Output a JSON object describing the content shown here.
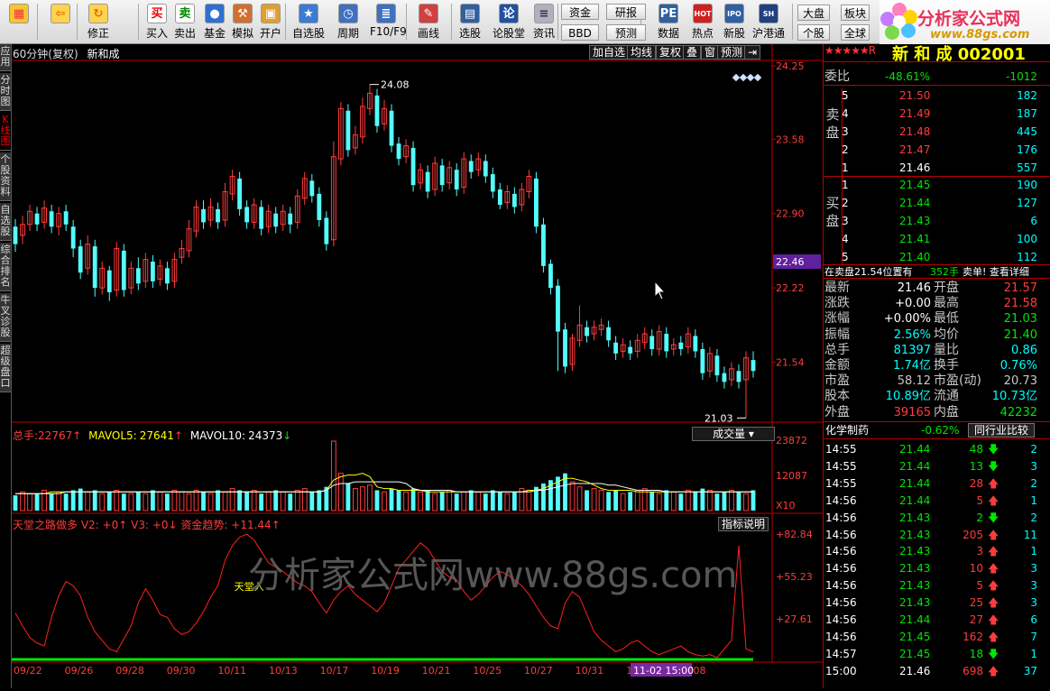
{
  "toolbar": {
    "buttons": [
      {
        "label": "",
        "icon": "grid-icon"
      },
      {
        "label": "",
        "icon": "back-arrow-icon"
      },
      {
        "label": "修正",
        "icon": "adjust-icon"
      },
      {
        "label": "买入",
        "icon": "buy-icon",
        "glyph": "买"
      },
      {
        "label": "卖出",
        "icon": "sell-icon",
        "glyph": "卖"
      },
      {
        "label": "基金",
        "icon": "fund-icon"
      },
      {
        "label": "模拟",
        "icon": "hammer-icon"
      },
      {
        "label": "开户",
        "icon": "lock-icon"
      },
      {
        "label": "自选股",
        "icon": "star-list-icon"
      },
      {
        "label": "周期",
        "icon": "clock-icon"
      },
      {
        "label": "F10/F9",
        "icon": "f10-icon"
      },
      {
        "label": "画线",
        "icon": "pen-icon"
      },
      {
        "label": "选股",
        "icon": "screen-icon"
      },
      {
        "label": "论股堂",
        "icon": "forum-icon",
        "glyph": "论"
      },
      {
        "label": "资讯",
        "icon": "news-icon"
      },
      {
        "label": "数据",
        "icon": "pe-icon",
        "glyph": "PE"
      },
      {
        "label": "热点",
        "icon": "hot-icon",
        "glyph": "HOT"
      },
      {
        "label": "新股",
        "icon": "ipo-icon",
        "glyph": "IPO"
      },
      {
        "label": "沪港通",
        "icon": "shhk-icon",
        "glyph": "SH HK"
      }
    ],
    "small": {
      "fund": "资金",
      "bbd": "BBD",
      "research": "研报",
      "forecast": "预测",
      "dapan": "大盘",
      "bankuai": "板块",
      "gegu": "个股",
      "quanqiu": "全球"
    }
  },
  "logo": {
    "line1": "分析家公式网",
    "line2": "www.88gs.com"
  },
  "lefttabs": [
    "应用",
    "分时图",
    "K线图",
    "个股资料",
    "自选股",
    "综合排名",
    "牛叉诊股",
    "超级盘口"
  ],
  "chart_header": {
    "title": "60分钟(复权)",
    "name": "新和成",
    "buttons": [
      "加自选",
      "均线",
      "复权",
      "叠",
      "窗",
      "预测",
      "⇥"
    ]
  },
  "price_axis": [
    "24.25",
    "23.58",
    "22.90",
    "22.22",
    "21.54"
  ],
  "current_price_label": "22.46",
  "volume_header": {
    "total_label": "总手:",
    "total": "22767",
    "mavol5_label": "MAVOL5:",
    "mavol5": "27641",
    "mavol10_label": "MAVOL10:",
    "mavol10": "24373",
    "button": "成交量"
  },
  "volume_axis": [
    "23872",
    "12087",
    "X10"
  ],
  "indicator_header": {
    "text1": "天堂之路做多",
    "v2": "V2: +0",
    "v3": "V3: +0",
    "fund_trend": "资金趋势: +11.44",
    "button": "指标说明"
  },
  "indicator_axis": [
    "+82.84",
    "+55.23",
    "+27.61"
  ],
  "indicator_marker": "天堂入",
  "watermark": "分析家公式网www.88gs.com",
  "date_axis": [
    "09/22",
    "09/26",
    "09/28",
    "09/30",
    "10/11",
    "10/13",
    "10/17",
    "10/19",
    "10/21",
    "10/25",
    "10/27",
    "10/31",
    "11/0",
    "11/08"
  ],
  "cursor_date": "11-02 15:00",
  "annotations": {
    "high": "24.08",
    "low": "21.03"
  },
  "right": {
    "stock_title": "新 和 成 002001",
    "weibi_label": "委比",
    "weibi": "-48.61%",
    "weicha": "-1012",
    "sell_label": "卖盘",
    "buy_label": "买盘",
    "sells": [
      {
        "lvl": "5",
        "price": "21.50",
        "vol": "182"
      },
      {
        "lvl": "4",
        "price": "21.49",
        "vol": "187"
      },
      {
        "lvl": "3",
        "price": "21.48",
        "vol": "445"
      },
      {
        "lvl": "2",
        "price": "21.47",
        "vol": "176"
      },
      {
        "lvl": "1",
        "price": "21.46",
        "vol": "557"
      }
    ],
    "buys": [
      {
        "lvl": "1",
        "price": "21.45",
        "vol": "190"
      },
      {
        "lvl": "2",
        "price": "21.44",
        "vol": "127"
      },
      {
        "lvl": "3",
        "price": "21.43",
        "vol": "6"
      },
      {
        "lvl": "4",
        "price": "21.41",
        "vol": "100"
      },
      {
        "lvl": "5",
        "price": "21.40",
        "vol": "112"
      }
    ],
    "notice_a": "在卖盘21.54位置有",
    "notice_b": "352手",
    "notice_c": "卖单! 查看详细",
    "quotes": [
      {
        "l1": "最新",
        "v1": "21.46",
        "c1": "white",
        "l2": "开盘",
        "v2": "21.57",
        "c2": "red"
      },
      {
        "l1": "涨跌",
        "v1": "+0.00",
        "c1": "white",
        "l2": "最高",
        "v2": "21.58",
        "c2": "red"
      },
      {
        "l1": "涨幅",
        "v1": "+0.00%",
        "c1": "white",
        "l2": "最低",
        "v2": "21.03",
        "c2": "green"
      },
      {
        "l1": "振幅",
        "v1": "2.56%",
        "c1": "cyan",
        "l2": "均价",
        "v2": "21.40",
        "c2": "green"
      },
      {
        "l1": "总手",
        "v1": "81397",
        "c1": "cyan",
        "l2": "量比",
        "v2": "0.86",
        "c2": "cyan"
      },
      {
        "l1": "金额",
        "v1": "1.74亿",
        "c1": "cyan",
        "l2": "换手",
        "v2": "0.76%",
        "c2": "cyan"
      },
      {
        "l1": "市盈",
        "v1": "58.12",
        "c1": "gray",
        "l2": "市盈(动)",
        "v2": "20.73",
        "c2": "gray"
      },
      {
        "l1": "股本",
        "v1": "10.89亿",
        "c1": "cyan",
        "l2": "流通",
        "v2": "10.73亿",
        "c2": "cyan"
      },
      {
        "l1": "外盘",
        "v1": "39165",
        "c1": "red",
        "l2": "内盘",
        "v2": "42232",
        "c2": "green"
      }
    ],
    "sector": "化学制药",
    "sector_change": "-0.62%",
    "peer_compare": "同行业比较",
    "ticks": [
      {
        "t": "14:55",
        "p": "21.44",
        "v": "48",
        "d": "down",
        "n": "2"
      },
      {
        "t": "14:55",
        "p": "21.44",
        "v": "13",
        "d": "down",
        "n": "3"
      },
      {
        "t": "14:55",
        "p": "21.44",
        "v": "28",
        "d": "up",
        "n": "2"
      },
      {
        "t": "14:56",
        "p": "21.44",
        "v": "5",
        "d": "up",
        "n": "1"
      },
      {
        "t": "14:56",
        "p": "21.43",
        "v": "2",
        "d": "down",
        "n": "2"
      },
      {
        "t": "14:56",
        "p": "21.43",
        "v": "205",
        "d": "up",
        "n": "11"
      },
      {
        "t": "14:56",
        "p": "21.43",
        "v": "3",
        "d": "up",
        "n": "1"
      },
      {
        "t": "14:56",
        "p": "21.43",
        "v": "10",
        "d": "up",
        "n": "3"
      },
      {
        "t": "14:56",
        "p": "21.43",
        "v": "5",
        "d": "up",
        "n": "3"
      },
      {
        "t": "14:56",
        "p": "21.43",
        "v": "25",
        "d": "up",
        "n": "3"
      },
      {
        "t": "14:56",
        "p": "21.44",
        "v": "27",
        "d": "up",
        "n": "6"
      },
      {
        "t": "14:56",
        "p": "21.45",
        "v": "162",
        "d": "up",
        "n": "7"
      },
      {
        "t": "14:57",
        "p": "21.45",
        "v": "18",
        "d": "down",
        "n": "1"
      },
      {
        "t": "15:00",
        "p": "21.46",
        "v": "698",
        "d": "up",
        "n": "37"
      }
    ]
  },
  "chart_data": {
    "type": "candlestick",
    "period": "60分钟",
    "ylim": [
      21.0,
      24.3
    ],
    "candles": [
      [
        22.78,
        22.62,
        22.85,
        22.55
      ],
      [
        22.7,
        22.8,
        22.88,
        22.62
      ],
      [
        22.8,
        22.92,
        22.98,
        22.74
      ],
      [
        22.9,
        22.8,
        22.96,
        22.74
      ],
      [
        22.82,
        22.95,
        23.02,
        22.76
      ],
      [
        22.92,
        22.78,
        22.98,
        22.72
      ],
      [
        22.78,
        22.9,
        22.96,
        22.7
      ],
      [
        22.92,
        22.8,
        22.98,
        22.74
      ],
      [
        22.78,
        22.58,
        22.84,
        22.5
      ],
      [
        22.6,
        22.36,
        22.66,
        22.3
      ],
      [
        22.4,
        22.62,
        22.7,
        22.34
      ],
      [
        22.6,
        22.22,
        22.66,
        22.14
      ],
      [
        22.22,
        22.4,
        22.46,
        22.16
      ],
      [
        22.38,
        22.18,
        22.42,
        22.1
      ],
      [
        22.2,
        22.58,
        22.64,
        22.14
      ],
      [
        22.56,
        22.2,
        22.62,
        22.14
      ],
      [
        22.22,
        22.4,
        22.46,
        22.16
      ],
      [
        22.4,
        22.26,
        22.5,
        22.2
      ],
      [
        22.28,
        22.48,
        22.54,
        22.22
      ],
      [
        22.46,
        22.28,
        22.52,
        22.22
      ],
      [
        22.3,
        22.42,
        22.48,
        22.24
      ],
      [
        22.4,
        22.26,
        22.46,
        22.2
      ],
      [
        22.28,
        22.48,
        22.54,
        22.22
      ],
      [
        22.5,
        22.58,
        22.66,
        22.44
      ],
      [
        22.56,
        22.76,
        22.84,
        22.5
      ],
      [
        22.74,
        22.96,
        23.02,
        22.68
      ],
      [
        22.94,
        22.82,
        23.02,
        22.76
      ],
      [
        22.84,
        22.96,
        23.04,
        22.78
      ],
      [
        22.94,
        22.82,
        23.0,
        22.76
      ],
      [
        22.84,
        23.1,
        23.18,
        22.78
      ],
      [
        23.08,
        23.24,
        23.3,
        23.02
      ],
      [
        23.22,
        22.94,
        23.28,
        22.88
      ],
      [
        22.96,
        22.82,
        23.02,
        22.76
      ],
      [
        22.82,
        22.98,
        23.04,
        22.76
      ],
      [
        22.96,
        22.76,
        23.02,
        22.7
      ],
      [
        22.78,
        22.92,
        22.98,
        22.72
      ],
      [
        22.9,
        22.78,
        22.96,
        22.72
      ],
      [
        22.8,
        22.92,
        22.98,
        22.74
      ],
      [
        22.9,
        22.8,
        22.96,
        22.72
      ],
      [
        22.82,
        23.06,
        23.12,
        22.76
      ],
      [
        23.04,
        23.22,
        23.28,
        22.98
      ],
      [
        23.2,
        23.06,
        23.26,
        23.0
      ],
      [
        23.08,
        22.84,
        23.14,
        22.78
      ],
      [
        22.86,
        22.62,
        22.92,
        22.56
      ],
      [
        22.66,
        23.42,
        23.56,
        22.6
      ],
      [
        23.4,
        23.86,
        23.92,
        23.34
      ],
      [
        23.84,
        23.48,
        23.9,
        23.42
      ],
      [
        23.5,
        23.62,
        23.7,
        23.44
      ],
      [
        23.6,
        23.88,
        23.96,
        23.54
      ],
      [
        23.86,
        24.0,
        24.08,
        23.8
      ],
      [
        23.98,
        23.7,
        24.04,
        23.64
      ],
      [
        23.72,
        23.86,
        23.94,
        23.66
      ],
      [
        23.84,
        23.52,
        23.9,
        23.46
      ],
      [
        23.54,
        23.4,
        23.6,
        23.34
      ],
      [
        23.42,
        23.52,
        23.58,
        23.36
      ],
      [
        23.5,
        23.16,
        23.56,
        23.1
      ],
      [
        23.18,
        23.3,
        23.36,
        23.12
      ],
      [
        23.28,
        23.1,
        23.34,
        23.04
      ],
      [
        23.12,
        23.36,
        23.42,
        23.06
      ],
      [
        23.34,
        23.16,
        23.4,
        23.1
      ],
      [
        23.18,
        23.32,
        23.38,
        23.12
      ],
      [
        23.3,
        23.12,
        23.36,
        23.06
      ],
      [
        23.14,
        23.4,
        23.46,
        23.08
      ],
      [
        23.38,
        23.28,
        23.44,
        23.22
      ],
      [
        23.3,
        23.4,
        23.46,
        23.24
      ],
      [
        23.38,
        23.24,
        23.44,
        23.18
      ],
      [
        23.26,
        23.1,
        23.32,
        23.04
      ],
      [
        23.12,
        22.98,
        23.18,
        22.94
      ],
      [
        23.0,
        23.1,
        23.16,
        22.94
      ],
      [
        23.08,
        22.96,
        23.14,
        22.9
      ],
      [
        22.98,
        23.12,
        23.18,
        22.92
      ],
      [
        23.1,
        23.24,
        23.3,
        23.04
      ],
      [
        23.22,
        22.78,
        23.28,
        22.72
      ],
      [
        22.8,
        22.42,
        22.86,
        22.36
      ],
      [
        22.44,
        22.22,
        22.48,
        22.16
      ],
      [
        22.24,
        21.82,
        22.3,
        21.46
      ],
      [
        21.84,
        21.5,
        21.9,
        21.44
      ],
      [
        21.52,
        21.76,
        21.8,
        21.46
      ],
      [
        21.74,
        21.88,
        22.06,
        21.68
      ],
      [
        21.86,
        21.78,
        21.92,
        21.72
      ],
      [
        21.8,
        21.86,
        21.92,
        21.74
      ],
      [
        21.84,
        21.88,
        21.94,
        21.78
      ],
      [
        21.86,
        21.74,
        21.92,
        21.68
      ],
      [
        21.72,
        21.62,
        21.78,
        21.56
      ],
      [
        21.64,
        21.7,
        21.76,
        21.58
      ],
      [
        21.68,
        21.62,
        21.74,
        21.56
      ],
      [
        21.64,
        21.74,
        21.8,
        21.58
      ],
      [
        21.72,
        21.8,
        21.86,
        21.66
      ],
      [
        21.78,
        21.66,
        21.84,
        21.6
      ],
      [
        21.66,
        21.82,
        21.88,
        21.6
      ],
      [
        21.8,
        21.64,
        21.86,
        21.58
      ],
      [
        21.66,
        21.7,
        21.76,
        21.6
      ],
      [
        21.72,
        21.66,
        21.78,
        21.6
      ],
      [
        21.68,
        21.8,
        21.86,
        21.62
      ],
      [
        21.78,
        21.64,
        21.84,
        21.58
      ],
      [
        21.66,
        21.44,
        21.72,
        21.38
      ],
      [
        21.46,
        21.62,
        21.68,
        21.4
      ],
      [
        21.6,
        21.42,
        21.66,
        21.36
      ],
      [
        21.44,
        21.36,
        21.5,
        21.3
      ],
      [
        21.38,
        21.48,
        21.54,
        21.32
      ],
      [
        21.46,
        21.36,
        21.52,
        21.3
      ],
      [
        21.38,
        21.58,
        21.64,
        21.03
      ],
      [
        21.56,
        21.46,
        21.64,
        21.4
      ]
    ],
    "volumes": [
      9,
      11,
      10,
      10,
      12,
      10,
      11,
      10,
      12,
      13,
      11,
      12,
      10,
      11,
      12,
      10,
      10,
      11,
      10,
      12,
      11,
      10,
      12,
      11,
      10,
      12,
      11,
      10,
      12,
      11,
      13,
      12,
      11,
      12,
      10,
      11,
      12,
      11,
      10,
      12,
      13,
      11,
      12,
      14,
      41,
      22,
      16,
      13,
      14,
      15,
      12,
      11,
      13,
      12,
      11,
      13,
      11,
      12,
      10,
      11,
      12,
      10,
      11,
      12,
      11,
      10,
      12,
      11,
      10,
      11,
      13,
      12,
      14,
      16,
      18,
      20,
      22,
      17,
      14,
      12,
      13,
      12,
      11,
      12,
      10,
      11,
      12,
      13,
      11,
      10,
      12,
      11,
      10,
      12,
      11,
      13,
      12,
      10,
      11,
      12,
      11,
      10,
      12
    ],
    "mavol5": [
      10,
      10,
      10,
      10,
      10,
      11,
      11,
      11,
      11,
      11,
      11,
      11,
      11,
      11,
      11,
      11,
      11,
      11,
      11,
      11,
      11,
      11,
      11,
      11,
      11,
      11,
      11,
      11,
      11,
      11,
      11,
      11,
      11,
      11,
      11,
      11,
      11,
      11,
      11,
      11,
      11,
      11,
      11,
      12,
      18,
      20,
      21,
      21,
      22,
      20,
      14,
      13,
      13,
      12,
      12,
      12,
      12,
      11,
      11,
      11,
      11,
      11,
      11,
      11,
      11,
      11,
      11,
      11,
      11,
      11,
      11,
      12,
      12,
      13,
      15,
      17,
      19,
      19,
      18,
      17,
      15,
      13,
      12,
      12,
      12,
      12,
      11,
      11,
      11,
      11,
      11,
      11,
      11,
      11,
      11,
      11,
      11,
      11,
      11,
      11,
      11,
      11,
      11
    ],
    "mavol10": [
      10,
      10,
      10,
      10,
      10,
      10,
      10,
      11,
      11,
      11,
      11,
      11,
      11,
      11,
      11,
      11,
      11,
      11,
      11,
      11,
      11,
      11,
      11,
      11,
      11,
      11,
      11,
      11,
      11,
      11,
      11,
      11,
      11,
      11,
      11,
      11,
      11,
      11,
      11,
      11,
      11,
      11,
      11,
      12,
      15,
      16,
      16,
      17,
      17,
      17,
      17,
      17,
      17,
      17,
      16,
      13,
      12,
      12,
      12,
      12,
      12,
      11,
      11,
      11,
      11,
      11,
      11,
      11,
      11,
      11,
      11,
      11,
      12,
      12,
      13,
      14,
      15,
      16,
      16,
      16,
      16,
      16,
      15,
      15,
      14,
      13,
      12,
      12,
      12,
      12,
      11,
      11,
      11,
      11,
      11,
      11,
      11,
      11,
      11,
      11,
      11,
      11,
      11
    ],
    "indicator": [
      33,
      24,
      16,
      12,
      10,
      30,
      45,
      55,
      52,
      45,
      30,
      20,
      14,
      8,
      6,
      15,
      24,
      40,
      50,
      42,
      32,
      30,
      22,
      18,
      20,
      26,
      34,
      44,
      52,
      70,
      80,
      86,
      88,
      84,
      76,
      68,
      65,
      62,
      58,
      54,
      52,
      48,
      40,
      33,
      42,
      48,
      52,
      46,
      42,
      38,
      34,
      40,
      52,
      64,
      70,
      76,
      82,
      78,
      70,
      62,
      58,
      56,
      48,
      42,
      46,
      52,
      58,
      62,
      60,
      56,
      52,
      46,
      38,
      30,
      24,
      22,
      40,
      48,
      44,
      32,
      20,
      14,
      10,
      6,
      8,
      12,
      14,
      10,
      6,
      4,
      6,
      8,
      10,
      6,
      4,
      3,
      4,
      2,
      8,
      14,
      80,
      8,
      6
    ]
  }
}
